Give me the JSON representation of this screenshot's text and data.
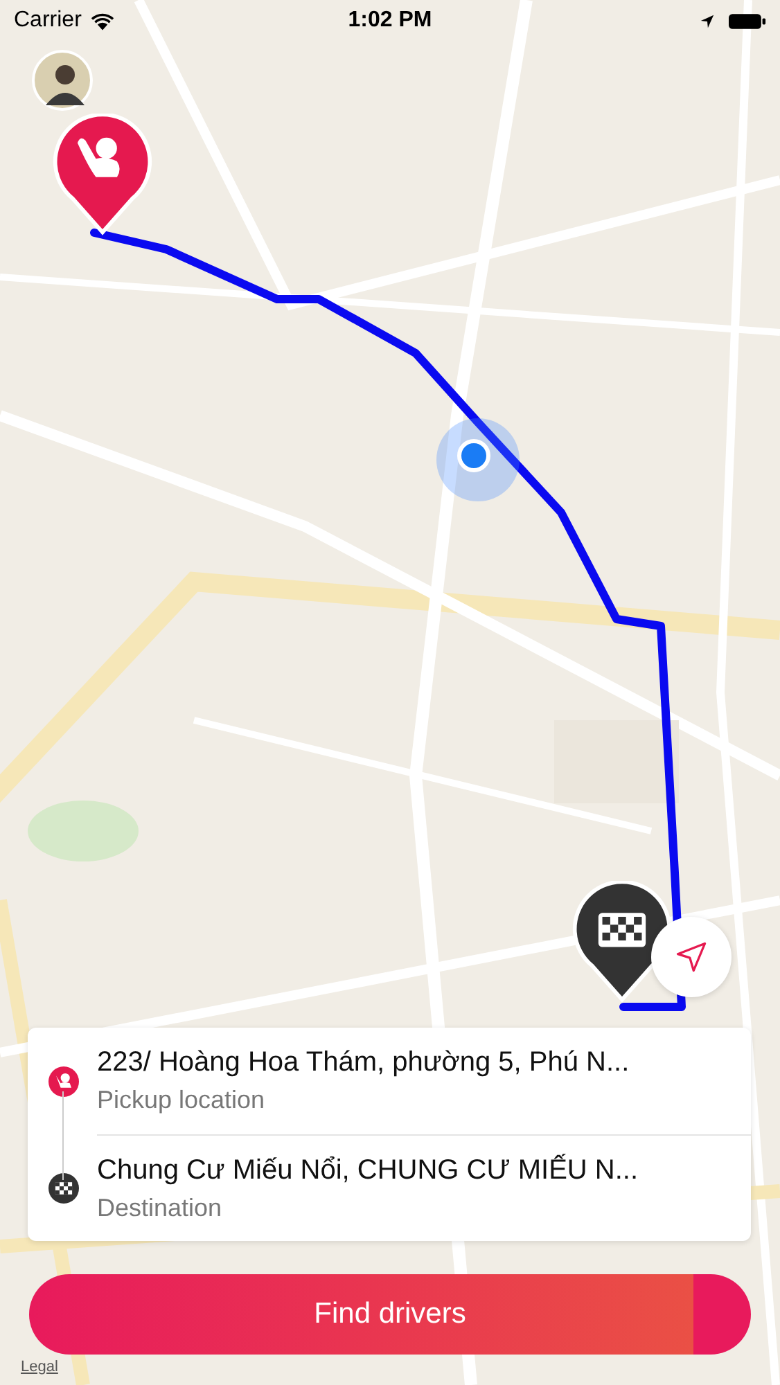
{
  "status_bar": {
    "carrier": "Carrier",
    "time": "1:02 PM"
  },
  "map": {
    "kind": "picture",
    "legal_link": "Legal"
  },
  "trip": {
    "stops": [
      {
        "kind": "pickup",
        "address": "223/ Hoàng Hoa Thám, phường 5, Phú N...",
        "label": "Pickup location"
      },
      {
        "kind": "destination",
        "address": "Chung Cư Miếu Nổi, CHUNG CƯ MIẾU N...",
        "label": "Destination"
      }
    ]
  },
  "action_button": {
    "label": "Find drivers"
  }
}
